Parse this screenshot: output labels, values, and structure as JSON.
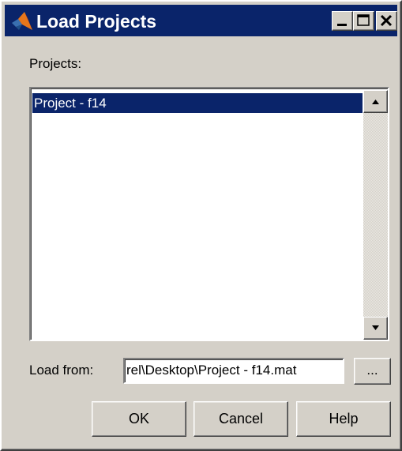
{
  "window": {
    "title": "Load Projects",
    "title_icon": "matlab-logo-icon",
    "controls": {
      "minimize": "minimize-icon",
      "maximize": "maximize-icon",
      "close": "close-icon"
    }
  },
  "projects": {
    "label": "Projects:",
    "items": [
      {
        "label": "Project - f14",
        "selected": true
      }
    ]
  },
  "load_from": {
    "label": "Load from:",
    "value": "rel\\Desktop\\Project - f14.mat",
    "browse_label": "..."
  },
  "buttons": {
    "ok": "OK",
    "cancel": "Cancel",
    "help": "Help"
  },
  "colors": {
    "titlebar": "#0a246a",
    "selection": "#0a246a",
    "face": "#d4d0c8"
  }
}
